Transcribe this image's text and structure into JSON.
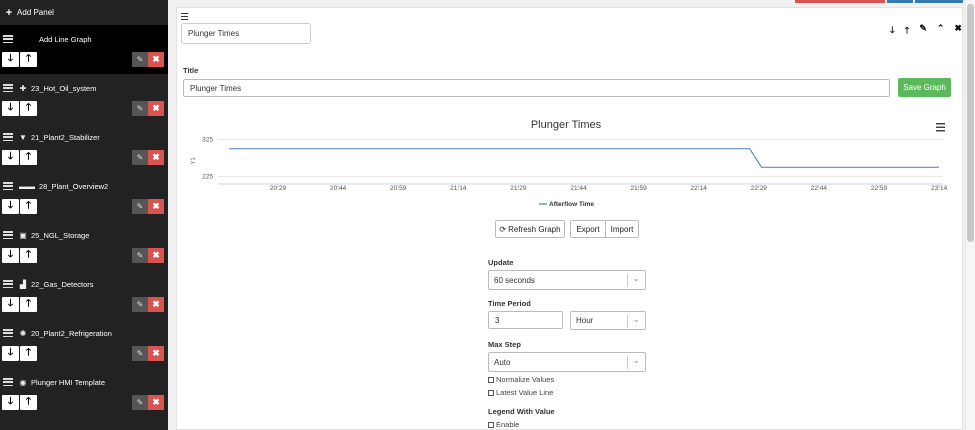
{
  "sidebar": {
    "add_panel_label": "Add Panel",
    "panels": [
      {
        "name": "Add Line Graph",
        "icon": "line-graph-icon",
        "glyph": ""
      },
      {
        "name": "23_Hot_Oil_system",
        "icon": "plus-cross-icon",
        "glyph": "✚"
      },
      {
        "name": "21_Plant2_Stabilizer",
        "icon": "filter-icon",
        "glyph": "▼"
      },
      {
        "name": "28_Plant_Overview2",
        "icon": "truck-icon",
        "glyph": "▬▬"
      },
      {
        "name": "25_NGL_Storage",
        "icon": "briefcase-icon",
        "glyph": "▣"
      },
      {
        "name": "22_Gas_Detectors",
        "icon": "bar-chart-icon",
        "glyph": "▟"
      },
      {
        "name": "20_Plant2_Refrigeration",
        "icon": "snowflake-icon",
        "glyph": "✺"
      },
      {
        "name": "Plunger HMI Template",
        "icon": "eye-icon",
        "glyph": "◉"
      }
    ]
  },
  "editor": {
    "panel_name_value": "Plunger Times",
    "title_label": "Title",
    "title_value": "Plunger Times",
    "save_button": "Save Graph",
    "refresh_button": "Refresh Graph",
    "export_button": "Export",
    "import_button": "Import",
    "update_label": "Update",
    "update_value": "60 seconds",
    "time_period_label": "Time Period",
    "time_period_value": "3",
    "time_unit_value": "Hour",
    "max_step_label": "Max Step",
    "max_step_value": "Auto",
    "normalize_label": "Normalize Values",
    "latest_value_label": "Latest Value Line",
    "legend_label": "Legend With Value",
    "enable_label": "Enable"
  },
  "chart_data": {
    "type": "line",
    "title": "Plunger Times",
    "ylabel": "Y1",
    "yticks": [
      225,
      325
    ],
    "ylim": [
      215,
      335
    ],
    "xticks": [
      "20:29",
      "20:44",
      "20:59",
      "21:14",
      "21:29",
      "21:44",
      "21:59",
      "22:14",
      "22:29",
      "22:44",
      "22:59",
      "23:14"
    ],
    "xlim_minutes": [
      0,
      180
    ],
    "series": [
      {
        "name": "Afterflow Time",
        "color": "#4a7fc1",
        "x_minutes": [
          0,
          132,
          135,
          180
        ],
        "y": [
          300,
          300,
          250,
          250
        ]
      }
    ],
    "legend_position": "bottom-center"
  },
  "colors": {
    "sidebar_bg": "#222222",
    "save_green": "#5cb85c",
    "delete_red": "#d9534f",
    "series_blue": "#4a7fc1"
  }
}
